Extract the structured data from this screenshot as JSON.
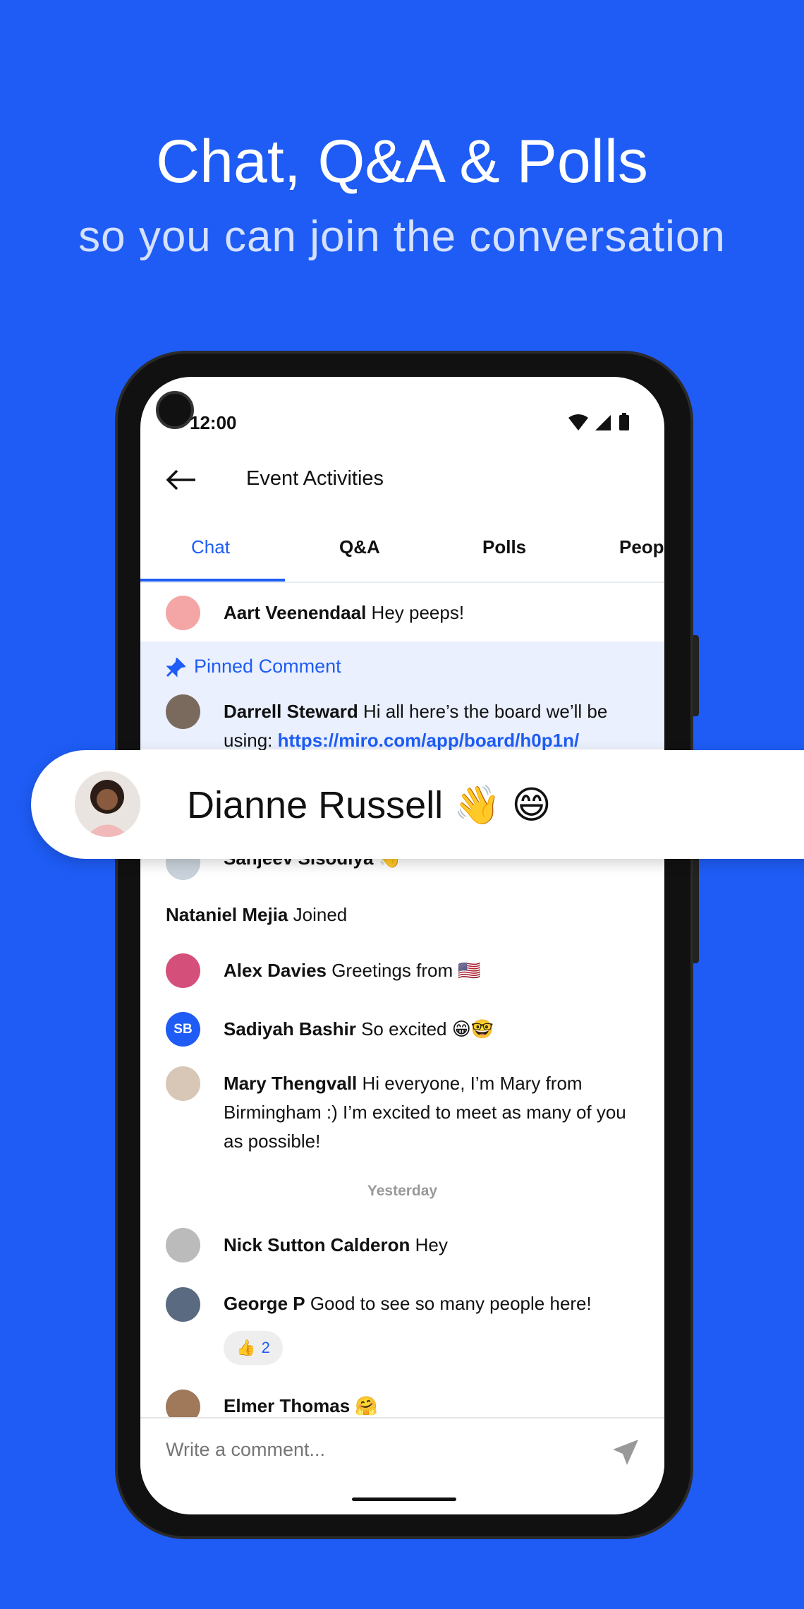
{
  "hero": {
    "title": "Chat, Q&A & Polls",
    "subtitle": "so you can join the conversation"
  },
  "colors": {
    "background": "#1e5cf5",
    "accent": "#1e5cf5",
    "pinned_bg": "#eaf0fd"
  },
  "status_bar": {
    "time": "12:00",
    "icons": [
      "wifi-icon",
      "signal-icon",
      "battery-icon"
    ]
  },
  "header": {
    "title": "Event Activities",
    "back_icon": "arrow-left-icon"
  },
  "tabs": [
    {
      "label": "Chat",
      "active": true
    },
    {
      "label": "Q&A"
    },
    {
      "label": "Polls"
    },
    {
      "label": "Peop"
    }
  ],
  "messages": {
    "aart": {
      "name": "Aart Veenendaal",
      "text": " Hey peeps!"
    },
    "pinned": {
      "label": "Pinned Comment",
      "name": "Darrell Steward",
      "text": " Hi all here’s the board we’ll be using: ",
      "link": "https://miro.com/app/board/h0p1n/"
    },
    "sanjeev": {
      "name": "Sanjeev Sisodiya",
      "text": " 👋"
    },
    "nataniel": {
      "name": "Nataniel Mejia",
      "text": " Joined"
    },
    "alex": {
      "name": "Alex Davies",
      "text": " Greetings from 🇺🇸"
    },
    "sadiyah": {
      "name": "Sadiyah Bashir",
      "text": " So excited 😁🤓",
      "initials": "SB"
    },
    "mary": {
      "name": "Mary Thengvall",
      "text": " Hi everyone, I’m Mary from Birmingham :) I’m excited to meet as many of you as possible!"
    },
    "divider": "Yesterday",
    "nick": {
      "name": "Nick Sutton Calderon",
      "text": " Hey"
    },
    "george": {
      "name": "George P",
      "text": " Good to see so many people here!",
      "reaction_count": "2"
    },
    "elmer": {
      "name": "Elmer Thomas",
      "text": " 🤗"
    }
  },
  "composer": {
    "placeholder": "Write a comment...",
    "send_icon": "send-icon"
  },
  "banner": {
    "text": "Dianne Russell 👋 😄"
  }
}
